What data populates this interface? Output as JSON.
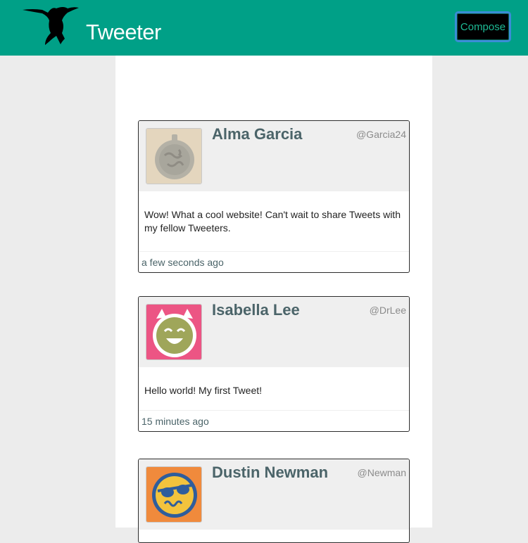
{
  "navbar": {
    "brand": "Tweeter",
    "compose_label": "Compose",
    "logo_icon": "hummingbird-icon",
    "background": "#00a087"
  },
  "tweets": [
    {
      "name": "Alma Garcia",
      "handle": "@Garcia24",
      "text": "Wow! What a cool website! Can't wait to share Tweets with my fellow Tweeters.",
      "timestamp": "a few seconds ago",
      "avatar_icon": "cookie-avatar-icon"
    },
    {
      "name": "Isabella Lee",
      "handle": "@DrLee",
      "text": "Hello world! My first Tweet!",
      "timestamp": "15 minutes ago",
      "avatar_icon": "devil-face-avatar-icon"
    },
    {
      "name": "Dustin Newman",
      "handle": "@Newman",
      "avatar_icon": "sunglasses-avatar-icon"
    }
  ]
}
